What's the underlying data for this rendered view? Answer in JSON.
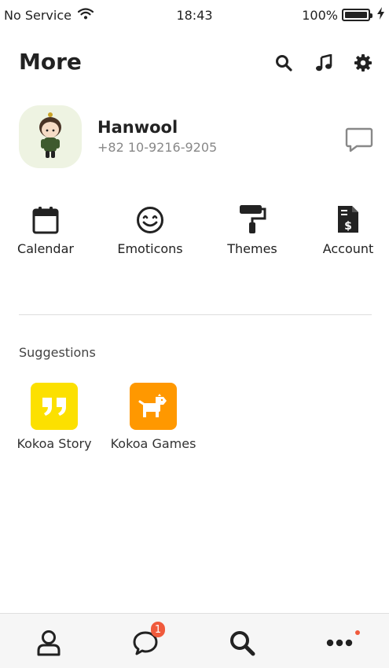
{
  "status_bar": {
    "carrier": "No Service",
    "time": "18:43",
    "battery": "100%"
  },
  "header": {
    "title": "More"
  },
  "profile": {
    "name": "Hanwool",
    "phone": "+82 10-9216-9205"
  },
  "shortcuts": [
    {
      "label": "Calendar",
      "icon": "calendar-icon"
    },
    {
      "label": "Emoticons",
      "icon": "smiley-icon"
    },
    {
      "label": "Themes",
      "icon": "paint-roller-icon"
    },
    {
      "label": "Account",
      "icon": "invoice-dollar-icon"
    }
  ],
  "suggestions": {
    "title": "Suggestions",
    "items": [
      {
        "label": "Kokoa Story",
        "icon": "quote-icon",
        "color": "#fce000"
      },
      {
        "label": "Kokoa Games",
        "icon": "dog-icon",
        "color": "#ff9800"
      }
    ]
  },
  "tabbar": {
    "items": [
      "person-icon",
      "chat-bubble-icon",
      "search-icon",
      "ellipsis-icon"
    ],
    "chats_badge": "1",
    "accent": "#f05a3c"
  }
}
